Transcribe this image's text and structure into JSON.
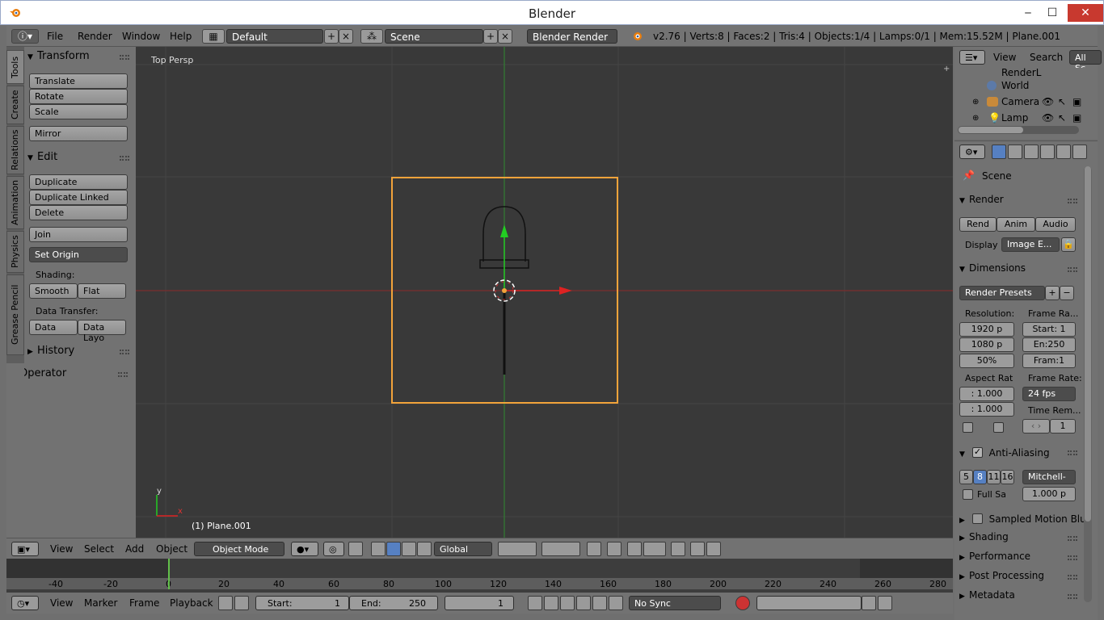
{
  "window": {
    "title": "Blender",
    "minimize": "‒",
    "maximize": "☐",
    "close": "✕"
  },
  "info_header": {
    "menus": [
      "File",
      "Render",
      "Window",
      "Help"
    ],
    "layout": "Default",
    "scene": "Scene",
    "engine": "Blender Render",
    "stats": "v2.76 | Verts:8 | Faces:2 | Tris:4 | Objects:1/4 | Lamps:0/1 | Mem:15.52M | Plane.001"
  },
  "tool_tabs": [
    "Tools",
    "Create",
    "Relations",
    "Animation",
    "Physics",
    "Grease Pencil"
  ],
  "tool_panel": {
    "transform": {
      "title": "Transform",
      "buttons": [
        "Translate",
        "Rotate",
        "Scale",
        "Mirror"
      ]
    },
    "edit": {
      "title": "Edit",
      "buttons": [
        "Duplicate",
        "Duplicate Linked",
        "Delete",
        "Join"
      ],
      "set_origin": "Set Origin"
    },
    "shading": {
      "label": "Shading:",
      "smooth": "Smooth",
      "flat": "Flat"
    },
    "data_transfer": {
      "label": "Data Transfer:",
      "data": "Data",
      "data_layout": "Data Layo"
    },
    "history": "History",
    "operator": "Operator"
  },
  "viewport": {
    "view_name": "Top Persp",
    "object_label": "(1) Plane.001",
    "axis_y": "y",
    "axis_x": "x"
  },
  "vp_header": {
    "menus": [
      "View",
      "Select",
      "Add",
      "Object"
    ],
    "mode": "Object Mode",
    "orientation": "Global"
  },
  "timeline": {
    "ticks": [
      "-40",
      "-20",
      "0",
      "20",
      "40",
      "60",
      "80",
      "100",
      "120",
      "140",
      "160",
      "180",
      "200",
      "220",
      "240",
      "260",
      "280"
    ],
    "menus": [
      "View",
      "Marker",
      "Frame",
      "Playback"
    ],
    "start_label": "Start:",
    "start": "1",
    "end_label": "End:",
    "end": "250",
    "current": "1",
    "sync": "No Sync"
  },
  "outliner": {
    "menus": [
      "View",
      "Search"
    ],
    "filter": "All Sc",
    "items": [
      "RenderL",
      "World",
      "Camera",
      "Lamp"
    ]
  },
  "properties": {
    "scene": "Scene",
    "render": {
      "title": "Render",
      "render_btn": "Rend",
      "anim_btn": "Anim",
      "audio_btn": "Audio",
      "display_label": "Display",
      "display_value": "Image E..."
    },
    "dimensions": {
      "title": "Dimensions",
      "presets": "Render Presets",
      "resolution_label": "Resolution:",
      "res_x": "1920 p",
      "res_y": "1080 p",
      "res_pct": "50%",
      "frame_range_label": "Frame Ra...",
      "start": "Start: 1",
      "end": "En:250",
      "frame": "Fram:1",
      "aspect_label": "Aspect Rat",
      "aspect_x": ": 1.000",
      "aspect_y": ": 1.000",
      "frame_rate_label": "Frame Rate:",
      "frame_rate": "24 fps",
      "time_remap_label": "Time Rem...",
      "time_remap": "1"
    },
    "anti_aliasing": {
      "title": "Anti-Aliasing",
      "samples": [
        "5",
        "8",
        "11",
        "16"
      ],
      "filter": "Mitchell-",
      "full_sample": "Full Sa",
      "size": "1.000 p"
    },
    "panels": [
      "Sampled Motion Blur",
      "Shading",
      "Performance",
      "Post Processing",
      "Metadata"
    ]
  }
}
